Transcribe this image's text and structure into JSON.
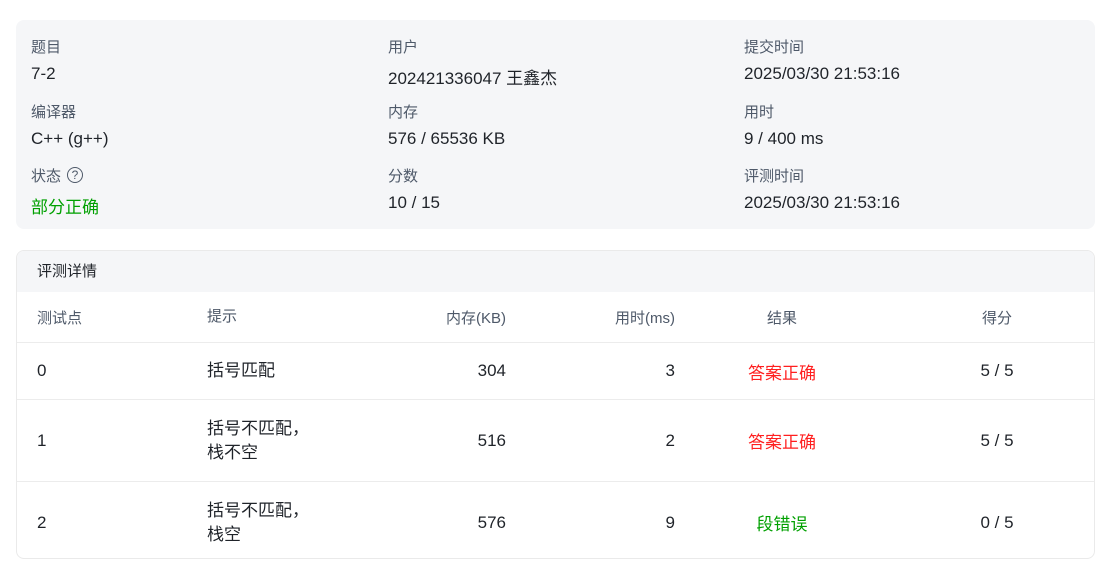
{
  "summary": {
    "problem_label": "题目",
    "problem": "7-2",
    "user_label": "用户",
    "user": "202421336047 王鑫杰",
    "submit_time_label": "提交时间",
    "submit_time": "2025/03/30 21:53:16",
    "compiler_label": "编译器",
    "compiler": "C++ (g++)",
    "memory_label": "内存",
    "memory": "576 / 65536 KB",
    "time_label": "用时",
    "time": "9 / 400 ms",
    "status_label": "状态",
    "status": "部分正确",
    "score_label": "分数",
    "score": "10 / 15",
    "judge_time_label": "评测时间",
    "judge_time": "2025/03/30 21:53:16"
  },
  "details": {
    "title": "评测详情",
    "columns": [
      "测试点",
      "提示",
      "内存(KB)",
      "用时(ms)",
      "结果",
      "得分"
    ],
    "rows": [
      {
        "id": "0",
        "hint": "括号匹配",
        "memory": "304",
        "time": "3",
        "result": "答案正确",
        "score": "5 / 5"
      },
      {
        "id": "1",
        "hint": "括号不匹配，栈不空",
        "memory": "516",
        "time": "2",
        "result": "答案正确",
        "score": "5 / 5"
      },
      {
        "id": "2",
        "hint": "括号不匹配，栈空",
        "memory": "576",
        "time": "9",
        "result": "段错误",
        "score": "0 / 5"
      }
    ]
  },
  "colors": {
    "accepted": "#ff1f1f",
    "segfault": "#00a000",
    "partial": "#00a000"
  }
}
